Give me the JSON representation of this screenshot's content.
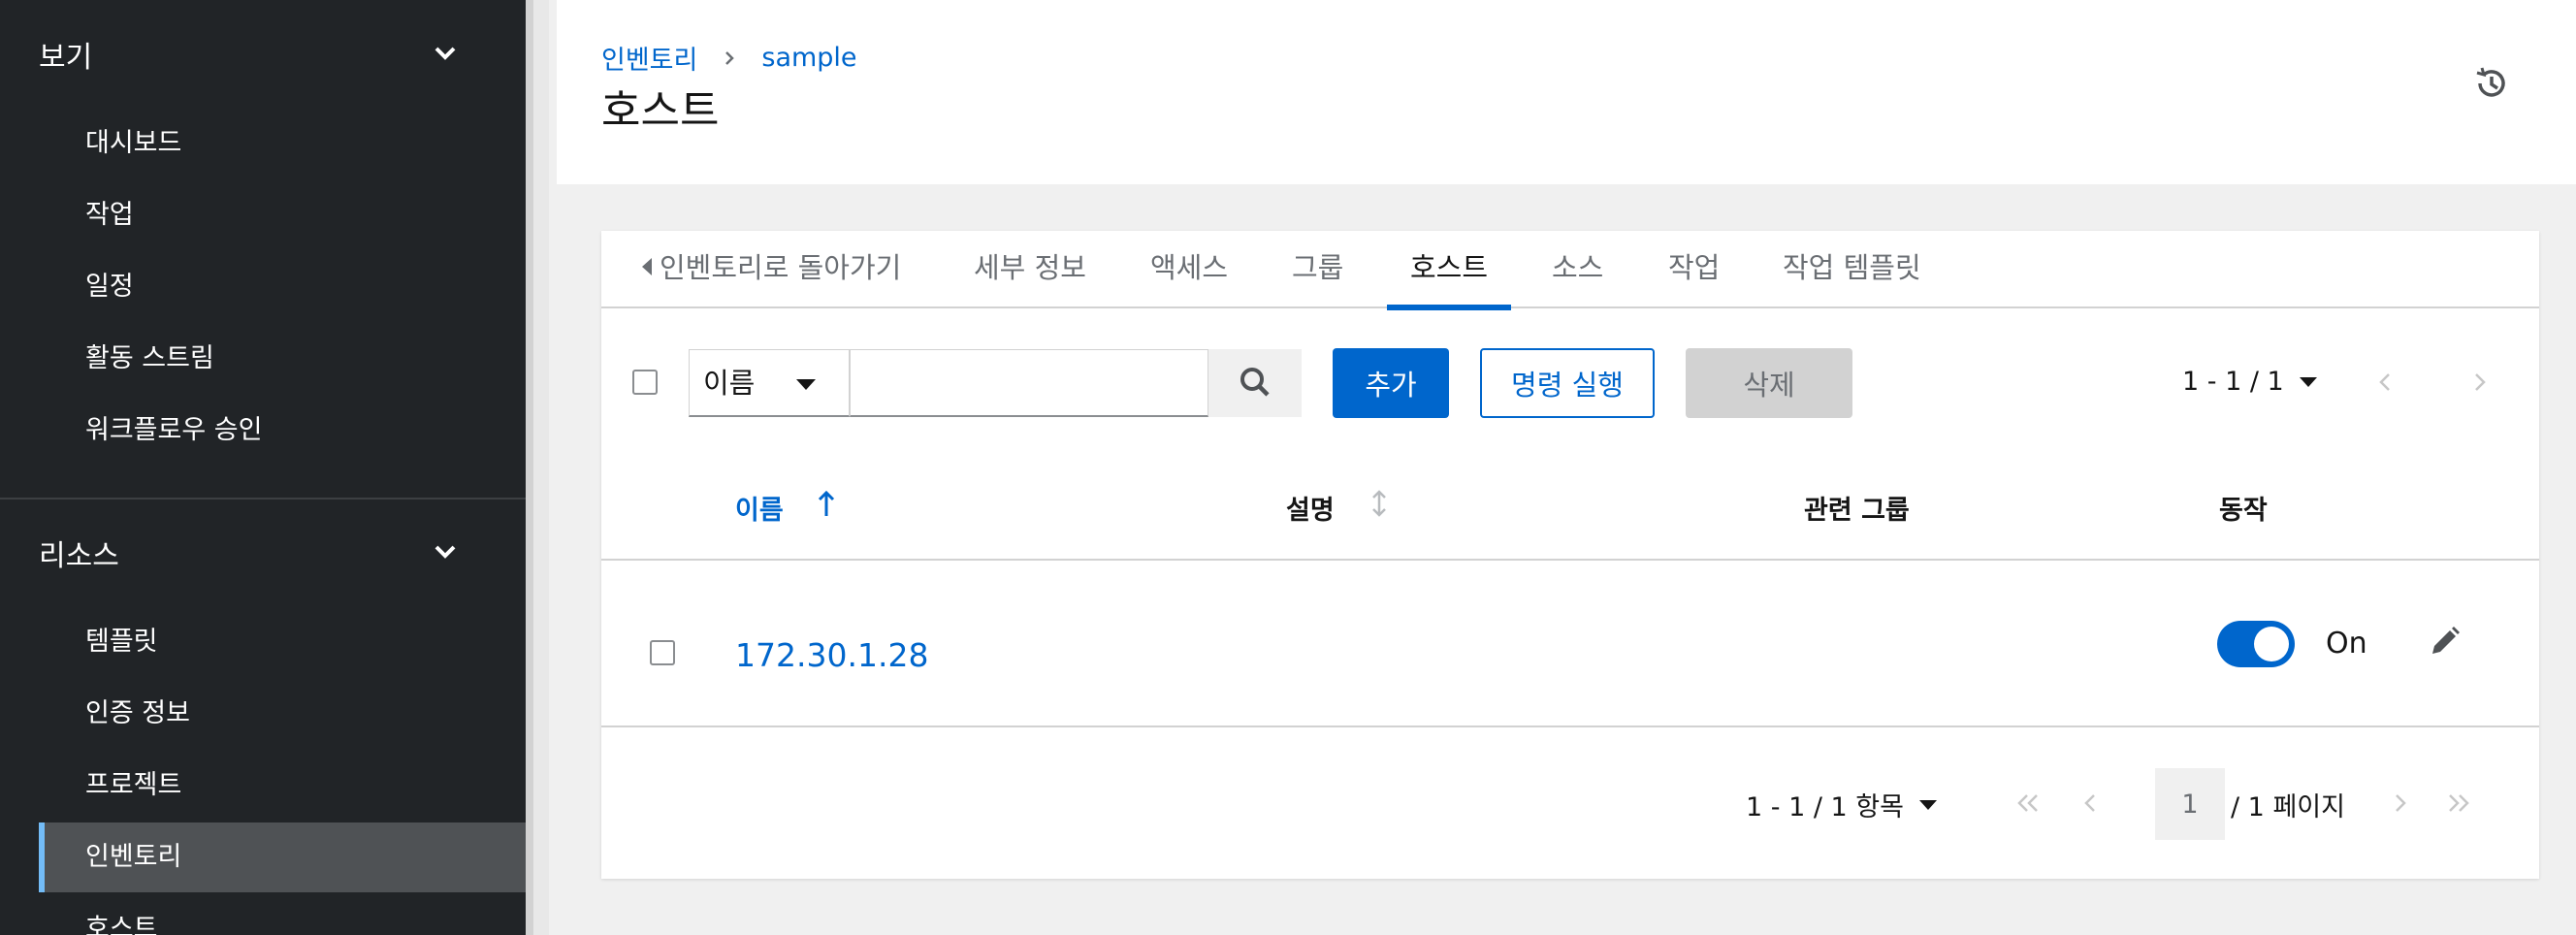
{
  "sidebar": {
    "groups": [
      {
        "title": "보기",
        "items": [
          "대시보드",
          "작업",
          "일정",
          "활동 스트림",
          "워크플로우 승인"
        ]
      },
      {
        "title": "리소스",
        "items": [
          "템플릿",
          "인증 정보",
          "프로젝트",
          "인벤토리",
          "호스트"
        ]
      }
    ],
    "active_item": "인벤토리"
  },
  "header": {
    "breadcrumb": [
      "인벤토리",
      "sample"
    ],
    "title": "호스트"
  },
  "tabs": [
    {
      "label": "인벤토리로 돌아가기",
      "back": true
    },
    {
      "label": "세부 정보"
    },
    {
      "label": "액세스"
    },
    {
      "label": "그룹"
    },
    {
      "label": "호스트",
      "active": true
    },
    {
      "label": "소스"
    },
    {
      "label": "작업"
    },
    {
      "label": "작업 템플릿"
    }
  ],
  "toolbar": {
    "filter_label": "이름",
    "search_value": "",
    "add_label": "추가",
    "run_command_label": "명령 실행",
    "delete_label": "삭제",
    "pagination": "1 - 1 / 1"
  },
  "table": {
    "columns": [
      "이름",
      "설명",
      "관련 그룹",
      "동작"
    ],
    "rows": [
      {
        "name": "172.30.1.28",
        "description": "",
        "groups": "",
        "enabled": true,
        "toggle_label": "On"
      }
    ]
  },
  "pagination": {
    "summary": "1 - 1 / 1 항목",
    "current_page": "1",
    "total_label": "/ 1 페이지"
  },
  "colors": {
    "sidebar_bg": "#212427",
    "accent": "#0066cc",
    "active_nav_indicator": "#73bcf7"
  }
}
